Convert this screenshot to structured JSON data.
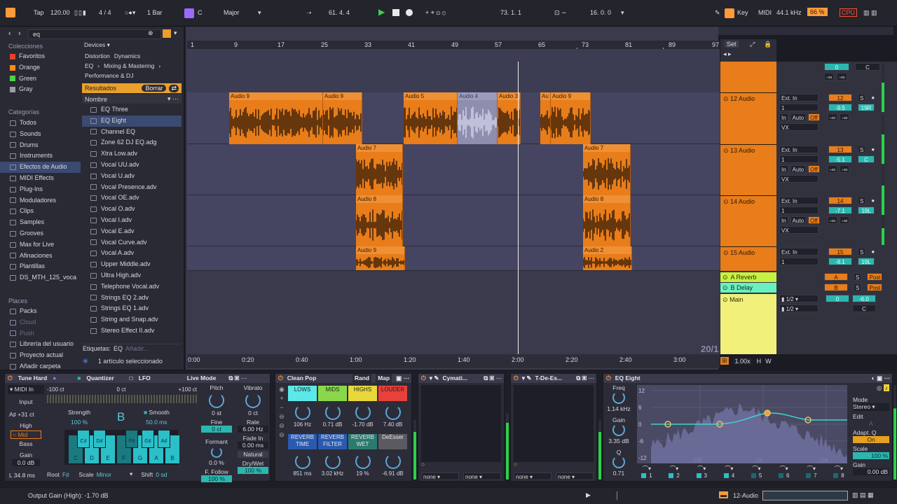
{
  "transport": {
    "tap": "Tap",
    "tempo": "120.00",
    "signature": "4 / 4",
    "quant": "1 Bar",
    "key": "C",
    "scale": "Major",
    "position": "61.  4.  4",
    "loop_start": "73.  1.  1",
    "loop_len": "16.  0.  0",
    "key_label": "Key",
    "midi_label": "MIDI",
    "sample_rate": "44.1 kHz",
    "cpu_pct": "66 %",
    "cpu_label": "CPU"
  },
  "browser": {
    "search_value": "eq",
    "sections": {
      "collections": "Colecciones",
      "categories": "Categorías",
      "places": "Places"
    },
    "collections": [
      {
        "label": "Favoritos",
        "color": "#e8402a"
      },
      {
        "label": "Orange",
        "color": "#ff8a1a"
      },
      {
        "label": "Green",
        "color": "#4ad24a"
      },
      {
        "label": "Gray",
        "color": "#9a9aa8"
      }
    ],
    "categories": [
      "Todos",
      "Sounds",
      "Drums",
      "Instruments",
      "Efectos de Audio",
      "MIDI Effects",
      "Plug-Ins",
      "Moduladores",
      "Clips",
      "Samples",
      "Grooves",
      "Max for Live",
      "Afinaciones",
      "Plantillas",
      "DS_MTH_125_voca"
    ],
    "places": [
      "Packs",
      "Cloud",
      "Push",
      "Librería del usuario",
      "Proyecto actual",
      "Añadir carpeta"
    ],
    "filter_devices": "Devices",
    "filter_tags": [
      "Distortion",
      "Dynamics",
      "EQ",
      "Mixing & Mastering",
      "Performance & DJ"
    ],
    "results_label": "Resultados",
    "clear_label": "Borrar",
    "name_header": "Nombre",
    "results": [
      "EQ Three",
      "EQ Eight",
      "Channel EQ",
      "Zone 62 DJ EQ.adg",
      "Xtra Low.adv",
      "Vocal UU.adv",
      "Vocal U.adv",
      "Vocal Presence.adv",
      "Vocal OE.adv",
      "Vocal O.adv",
      "Vocal I.adv",
      "Vocal E.adv",
      "Vocal Curve.adv",
      "Vocal A.adv",
      "Upper Middle.adv",
      "Ultra High.adv",
      "Telephone Vocal.adv",
      "Strings EQ 2.adv",
      "Strings EQ 1.adv",
      "String and Snap.adv",
      "Stereo Effect II.adv"
    ],
    "tags_label": "Etiquetas:",
    "tags_value": "EQ",
    "tags_add": "Añadir...",
    "selected_info": "1 artículo seleccionado"
  },
  "arrangement": {
    "bars": [
      "1",
      "9",
      "17",
      "25",
      "33",
      "41",
      "49",
      "57",
      "65",
      "73",
      "81",
      "89",
      "97"
    ],
    "times": [
      "0:00",
      "0:20",
      "0:40",
      "1:00",
      "1:20",
      "1:40",
      "2:00",
      "2:20",
      "2:40",
      "3:00"
    ],
    "page": "20/1",
    "zoom": "1.00x"
  },
  "clips": [
    [
      "Audio 9",
      "Audio 9",
      "Audio 5",
      "Audio 4",
      "Audio 3",
      "Au",
      "Audio 9"
    ],
    [
      "Audio 7",
      "Audio 7"
    ],
    [
      "Audio 8",
      "Audio 8"
    ],
    [
      "Audio 9",
      "Audio 2"
    ]
  ],
  "mixer": {
    "set_label": "Set",
    "tracks": [
      {
        "name": "12 Audio",
        "num": "12",
        "input": "Ext. In",
        "ch": "1",
        "vol": "-9.5",
        "pan": "19R",
        "mon_in": "In",
        "mon_auto": "Auto",
        "mon_off": "Off",
        "out": "VX",
        "s": "S",
        "send1": "-∞",
        "send2": "-∞"
      },
      {
        "name": "13 Audio",
        "num": "13",
        "input": "Ext. In",
        "ch": "1",
        "vol": "-5.1",
        "pan": "C",
        "mon_in": "In",
        "mon_auto": "Auto",
        "mon_off": "Off",
        "out": "VX",
        "s": "S",
        "send1": "-∞",
        "send2": "-∞"
      },
      {
        "name": "14 Audio",
        "num": "14",
        "input": "Ext. In",
        "ch": "1",
        "vol": "-7.1",
        "pan": "19L",
        "mon_in": "In",
        "mon_auto": "Auto",
        "mon_off": "Off",
        "out": "VX",
        "s": "S",
        "send1": "-∞",
        "send2": "-∞"
      },
      {
        "name": "15 Audio",
        "num": "15",
        "input": "Ext. In",
        "ch": "1",
        "vol": "-8.1",
        "pan": "19L",
        "s": "S"
      }
    ],
    "top": {
      "vol": "0",
      "pan": "C",
      "send1": "-∞",
      "send2": "-∞"
    },
    "returns": [
      {
        "name": "A Reverb",
        "letter": "A",
        "s": "S",
        "post": "Post"
      },
      {
        "name": "B Delay",
        "letter": "B",
        "s": "S",
        "post": "Post"
      }
    ],
    "main": {
      "name": "Main",
      "out1": "1/2",
      "out2": "1/2",
      "vol": "0",
      "pan": "-6.0",
      "pan2": "C"
    }
  },
  "devices": {
    "tune": {
      "title": "Tune Hard",
      "midi": "MIDI In",
      "input": "Input",
      "note": "A♯ +31 ct",
      "high": "High",
      "mid": "Mid",
      "bass": "Bass",
      "gain": "Gain",
      "gain_val": "0.0 dB",
      "lat": "L 34.8 ms",
      "quantizer": "Quantizer",
      "lfo": "LFO",
      "live_mode": "Live Mode",
      "ct_min": "-100 ct",
      "ct_mid": "0 ct",
      "ct_max": "+100 ct",
      "strength": "Strength",
      "strength_val": "100 %",
      "key": "B",
      "smooth": "Smooth",
      "smooth_val": "50.0 ms",
      "pitch": "Pitch",
      "pitch_val": "0 st",
      "fine": "Fine",
      "fine_val": "0 ct",
      "formant": "Formant",
      "formant_val": "0.0 %",
      "follow": "F. Follow",
      "follow_val": "100 %",
      "vibrato": "Vibrato",
      "vibrato_val": "0 ct",
      "rate": "Rate",
      "rate_val": "6.00 Hz",
      "fade": "Fade In",
      "fade_val": "0.00 ms",
      "natural": "Natural",
      "drywet": "Dry/Wet",
      "drywet_val": "100 %",
      "root": "Root",
      "root_val": "F♯",
      "scale": "Scale",
      "scale_val": "Minor",
      "shift": "Shift",
      "shift_val": "0 sd",
      "notes": [
        "C",
        "D",
        "E",
        "F",
        "G",
        "A",
        "B"
      ],
      "sharps": [
        "C♯",
        "D♯",
        "F♯",
        "G♯",
        "A♯"
      ]
    },
    "pop": {
      "title": "Clean Pop",
      "rand": "Rand",
      "map": "Map",
      "buttons": [
        "LOWS",
        "MIDS",
        "HIGHS",
        "LOUDER"
      ],
      "top_vals": [
        "106 Hz",
        "0.71 dB",
        "-1.70 dB",
        "7.40 dB"
      ],
      "buttons2": [
        "REVERB TIME",
        "REVERB FILTER",
        "REVERB WET",
        "DeEsser"
      ],
      "bot_vals": [
        "851 ms",
        "3.02 kHz",
        "19 %",
        "-6.91 dB"
      ]
    },
    "cym": {
      "title": "Cymati...",
      "none1": "none",
      "none2": "none"
    },
    "tde": {
      "title": "T-De-Es...",
      "none1": "none",
      "none2": "none"
    },
    "eq": {
      "title": "EQ Eight",
      "freq": "Freq",
      "freq_val": "1.14 kHz",
      "gain": "Gain",
      "gain_val": "3.35 dB",
      "q": "Q",
      "q_val": "0.71",
      "db_ticks": [
        "12",
        "6",
        "0",
        "-6",
        "-12"
      ],
      "hz_ticks": [
        "100",
        "1k",
        "10k"
      ],
      "mode": "Mode",
      "mode_val": "Stereo",
      "edit": "Edit",
      "edit_val": "A",
      "adapt": "Adapt. Q",
      "adapt_val": "On",
      "scale": "Scale",
      "scale_val": "100 %",
      "gain_r": "Gain",
      "gain_r_val": "0.00 dB",
      "bands": [
        "1",
        "2",
        "3",
        "4",
        "5",
        "6",
        "7",
        "8"
      ]
    }
  },
  "status": {
    "message": "Output Gain (High): -1.70 dB",
    "track": "12-Audio"
  }
}
